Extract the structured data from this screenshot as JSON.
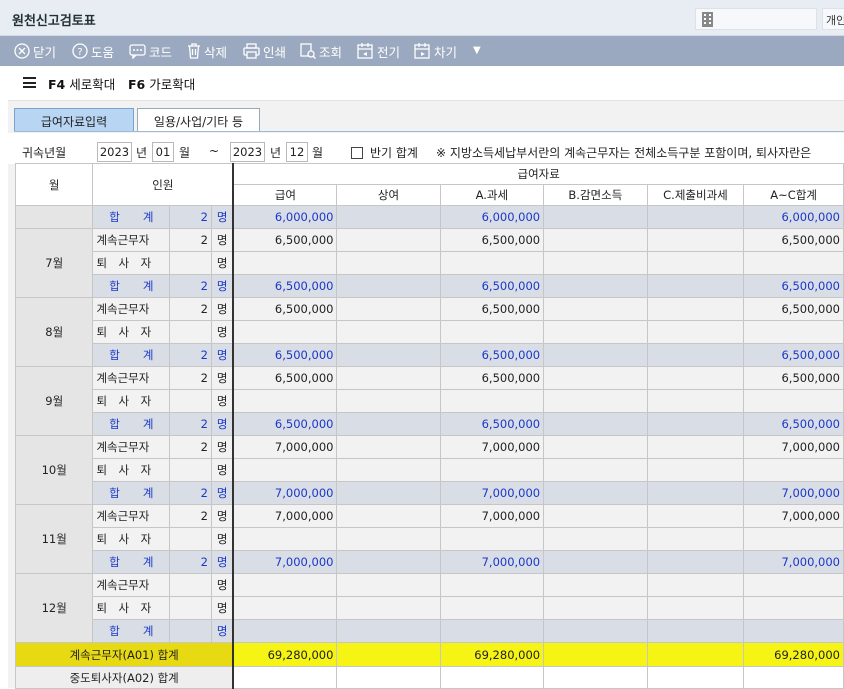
{
  "window": {
    "title": "원천신고검토표",
    "user_label": "개인"
  },
  "toolbar": {
    "close": "닫기",
    "help": "도움",
    "code": "코드",
    "delete": "삭제",
    "print": "인쇄",
    "search": "조회",
    "prev": "전기",
    "next": "차기"
  },
  "fkeys": {
    "f4_key": "F4",
    "f4_label": "세로확대",
    "f6_key": "F6",
    "f6_label": "가로확대"
  },
  "tabs": [
    "급여자료입력",
    "일용/사업/기타 등"
  ],
  "filter": {
    "label": "귀속년월",
    "from_year": "2023",
    "year_unit": "년",
    "from_month": "01",
    "month_unit": "월",
    "tilde": "~",
    "to_year": "2023",
    "to_month": "12",
    "half_sum_label": "반기 합계",
    "notice": "※ 지방소득세납부서란의 계속근무자는 전체소득구분 포함이며, 퇴사자란은"
  },
  "grid": {
    "headers": {
      "month": "월",
      "people": "인원",
      "group": "급여자료",
      "cols": [
        "급여",
        "상여",
        "A.과세",
        "B.감면소득",
        "C.제출비과세",
        "A~C합계"
      ]
    },
    "unit_label": "명",
    "sum_label": "합　　계",
    "continuing_label": "계속근무자",
    "retired_label": "퇴　사　자",
    "total_row": {
      "count": "2",
      "salary": "6,000,000",
      "taxable": "6,000,000",
      "total": "6,000,000"
    },
    "months": [
      {
        "name": "7월",
        "cont_count": "2",
        "cont_salary": "6,500,000",
        "cont_taxable": "6,500,000",
        "cont_total": "6,500,000",
        "sum_count": "2",
        "sum_salary": "6,500,000",
        "sum_taxable": "6,500,000",
        "sum_total": "6,500,000"
      },
      {
        "name": "8월",
        "cont_count": "2",
        "cont_salary": "6,500,000",
        "cont_taxable": "6,500,000",
        "cont_total": "6,500,000",
        "sum_count": "2",
        "sum_salary": "6,500,000",
        "sum_taxable": "6,500,000",
        "sum_total": "6,500,000"
      },
      {
        "name": "9월",
        "cont_count": "2",
        "cont_salary": "6,500,000",
        "cont_taxable": "6,500,000",
        "cont_total": "6,500,000",
        "sum_count": "2",
        "sum_salary": "6,500,000",
        "sum_taxable": "6,500,000",
        "sum_total": "6,500,000"
      },
      {
        "name": "10월",
        "cont_count": "2",
        "cont_salary": "7,000,000",
        "cont_taxable": "7,000,000",
        "cont_total": "7,000,000",
        "sum_count": "2",
        "sum_salary": "7,000,000",
        "sum_taxable": "7,000,000",
        "sum_total": "7,000,000"
      },
      {
        "name": "11월",
        "cont_count": "2",
        "cont_salary": "7,000,000",
        "cont_taxable": "7,000,000",
        "cont_total": "7,000,000",
        "sum_count": "2",
        "sum_salary": "7,000,000",
        "sum_taxable": "7,000,000",
        "sum_total": "7,000,000"
      },
      {
        "name": "12월",
        "cont_count": "",
        "cont_salary": "",
        "cont_taxable": "",
        "cont_total": "",
        "sum_count": "",
        "sum_salary": "",
        "sum_taxable": "",
        "sum_total": ""
      }
    ],
    "a01_row": {
      "label": "계속근무자(A01) 합계",
      "salary": "69,280,000",
      "taxable": "69,280,000",
      "total": "69,280,000"
    },
    "a02_row": {
      "label": "중도퇴사자(A02) 합계"
    }
  },
  "colors": {
    "toolbar": "#9aa9bf",
    "sum_row_text": "#1a38c8",
    "highlight": "#f6f415",
    "tab_active": "#b8d5f3"
  }
}
